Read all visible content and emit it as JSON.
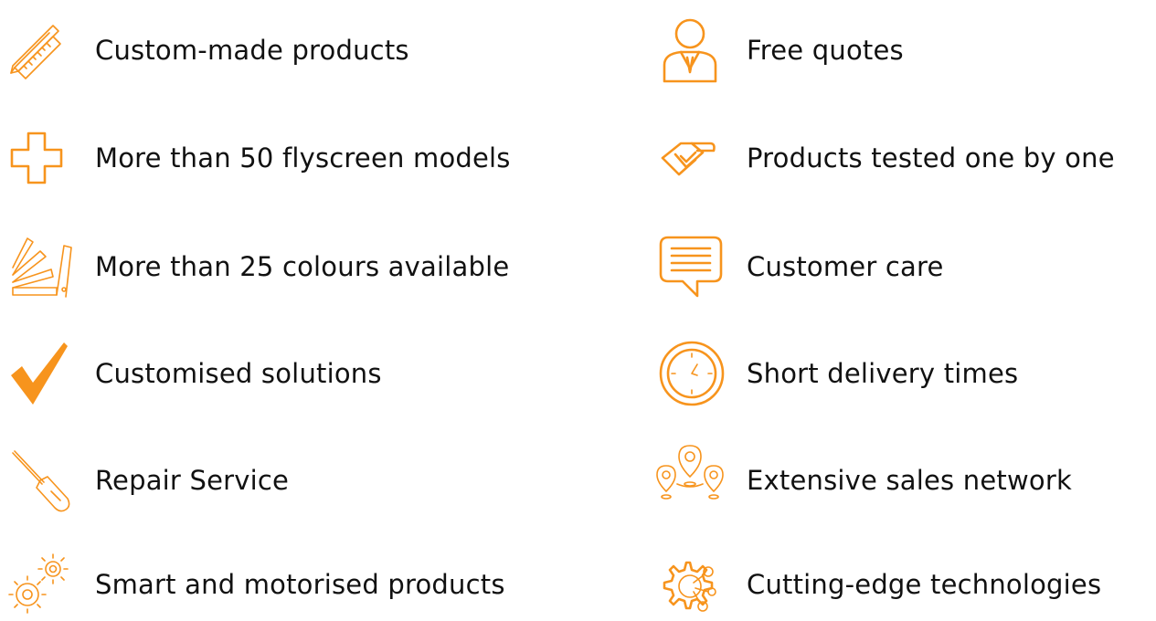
{
  "accent_color": "#f7941d",
  "features_left": [
    {
      "icon": "pencil-ruler-icon",
      "label": "Custom-made products"
    },
    {
      "icon": "plus-cross-icon",
      "label": "More than 50 flyscreen models"
    },
    {
      "icon": "colour-swatch-icon",
      "label": "More than 25 colours available"
    },
    {
      "icon": "checkmark-icon",
      "label": "Customised solutions"
    },
    {
      "icon": "screwdriver-icon",
      "label": "Repair Service"
    },
    {
      "icon": "gears-icon",
      "label": "Smart and motorised products"
    }
  ],
  "features_right": [
    {
      "icon": "person-tie-icon",
      "label": "Free quotes"
    },
    {
      "icon": "hand-tested-icon",
      "label": "Products tested one by one"
    },
    {
      "icon": "speech-bubble-icon",
      "label": "Customer care"
    },
    {
      "icon": "clock-icon",
      "label": "Short delivery times"
    },
    {
      "icon": "map-pins-icon",
      "label": "Extensive sales network"
    },
    {
      "icon": "gear-network-icon",
      "label": "Cutting-edge technologies"
    }
  ]
}
